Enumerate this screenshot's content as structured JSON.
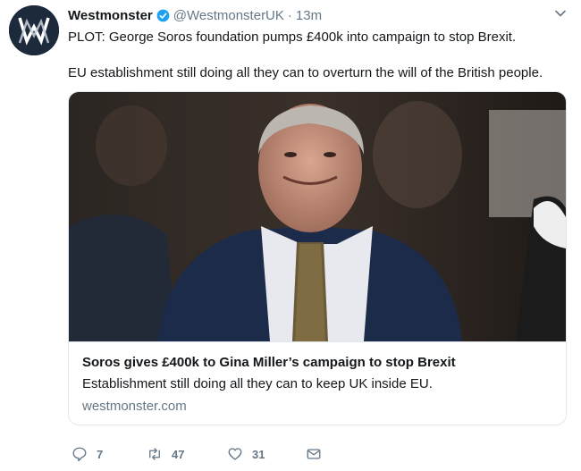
{
  "tweet": {
    "display_name": "Westmonster",
    "handle": "@WestmonsterUK",
    "separator": "·",
    "time": "13m",
    "text_line1": "PLOT: George Soros foundation pumps £400k into campaign to stop Brexit.",
    "text_line2": "EU establishment still doing all they can to overturn the will of the British people."
  },
  "card": {
    "title": "Soros gives £400k to Gina Miller’s campaign to stop Brexit",
    "description": "Establishment still doing all they can to keep UK inside EU.",
    "domain": "westmonster.com"
  },
  "actions": {
    "reply_count": "7",
    "retweet_count": "47",
    "like_count": "31"
  },
  "icons": [
    "avatar-logo",
    "verified-badge-icon",
    "chevron-down-icon",
    "reply-icon",
    "retweet-icon",
    "heart-icon",
    "message-icon"
  ],
  "colors": {
    "verified": "#1da1f2",
    "text": "#14171a",
    "secondary": "#657786",
    "border": "#e1e8ed"
  }
}
